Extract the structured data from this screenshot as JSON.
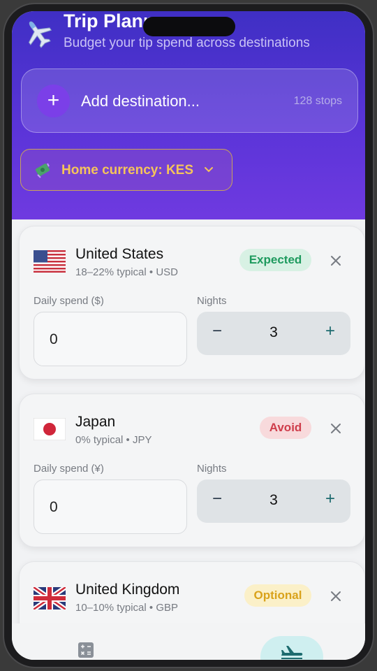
{
  "header": {
    "title": "Trip Planner",
    "subtitle": "Budget your tip spend across destinations",
    "icon": "airplane-icon",
    "add_destination": {
      "label": "Add destination...",
      "count": "128 stops"
    },
    "currency": {
      "label": "Home currency: KES",
      "icon": "money-icon"
    }
  },
  "cards": [
    {
      "country": "United States",
      "meta": "18–22% typical • USD",
      "badge": "Expected",
      "spend_label": "Daily spend ($)",
      "spend_value": "0",
      "nights_label": "Nights",
      "nights_value": "3",
      "minus": "−",
      "plus": "+"
    },
    {
      "country": "Japan",
      "meta": "0% typical • JPY",
      "badge": "Avoid",
      "spend_label": "Daily spend (¥)",
      "spend_value": "0",
      "nights_label": "Nights",
      "nights_value": "3",
      "minus": "−",
      "plus": "+"
    },
    {
      "country": "United Kingdom",
      "meta": "10–10% typical • GBP",
      "badge": "Optional"
    }
  ],
  "colors": {
    "header_gradient_top": "#3f2fc4",
    "header_gradient_bottom": "#6f3ae0",
    "accent_purple": "#7b3fe8",
    "currency_text": "#f5c45a",
    "expected": "#1e9a5e",
    "avoid": "#cf3d4b",
    "optional": "#d9a21b"
  },
  "bottom_nav": {
    "items": [
      "calculator-icon",
      "airplane-icon"
    ]
  }
}
